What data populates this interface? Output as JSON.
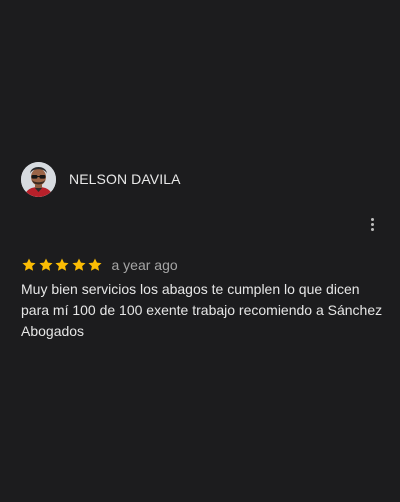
{
  "review": {
    "reviewer_name": "NELSON DAVILA",
    "rating": 5,
    "max_rating": 5,
    "date": "a year ago",
    "text": "Muy bien servicios los abagos te cumplen lo que dicen para mí 100 de 100 exente trabajo recomiendo a Sánchez Abogados",
    "star_color": "#fbbc04"
  },
  "icons": {
    "avatar": "reviewer-avatar-photo",
    "menu": "more-vert-icon",
    "star": "star-icon"
  },
  "colors": {
    "background": "#1c1c1e",
    "name": "#e8e8e8",
    "date": "#a5a5a5",
    "body_text": "#e6e6e6"
  }
}
